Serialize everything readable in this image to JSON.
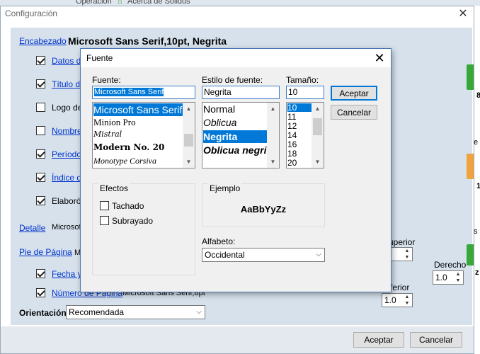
{
  "background": {
    "menu_operacion": "Operación",
    "menu_acerca": "Acerca de Solidus"
  },
  "config": {
    "title": "Configuración",
    "encabezado": {
      "label": "Encabezado",
      "font_value": "Microsoft Sans Serif,10pt, Negrita"
    },
    "encabezado_items": [
      {
        "label": "Datos de",
        "checked": true,
        "link": true
      },
      {
        "label": "Título del",
        "checked": true,
        "link": true
      },
      {
        "label": "Logo del I",
        "checked": false,
        "link": false
      },
      {
        "label": "Nombre d",
        "checked": false,
        "link": true
      },
      {
        "label": "Período",
        "checked": true,
        "link": true
      },
      {
        "label": "Índice del",
        "checked": true,
        "link": true
      },
      {
        "label": "Elaboró",
        "checked": true,
        "link": false
      }
    ],
    "detalle": {
      "label": "Detalle",
      "value": "Microsoft"
    },
    "pie": {
      "label": "Pie de Página",
      "value": "Mic"
    },
    "pie_items": [
      {
        "label": "Fecha y H",
        "checked": true,
        "value": ""
      },
      {
        "label": "Número de Página",
        "checked": true,
        "value": "Microsoft Sans Serif,8pt"
      }
    ],
    "orientacion": {
      "label": "Orientación",
      "value": "Recomendada"
    },
    "margins": {
      "superior_label": "uperior",
      "superior_value": "0",
      "derecho_label": "Derecho",
      "derecho_value": "1.0",
      "inferior_label": "ferior",
      "inferior_value": "1.0"
    },
    "side_fragments": {
      "a": "8",
      "b": "e",
      "c": "1",
      "d": "s",
      "e": "z"
    },
    "accept_label": "Aceptar",
    "cancel_label": "Cancelar"
  },
  "font_dialog": {
    "title": "Fuente",
    "fuente_label": "Fuente:",
    "fuente_value": "Microsoft Sans Serif",
    "fuente_list": [
      "Microsoft Sans Serif",
      "Minion Pro",
      "Mistral",
      "Modern No. 20",
      "Monotype Corsiva"
    ],
    "estilo_label": "Estilo de fuente:",
    "estilo_value": "Negrita",
    "estilo_list": [
      "Normal",
      "Oblicua",
      "Negrita",
      "Oblicua negrita"
    ],
    "tamano_label": "Tamaño:",
    "tamano_value": "10",
    "tamano_list": [
      "10",
      "11",
      "12",
      "14",
      "16",
      "18",
      "20"
    ],
    "accept_label": "Aceptar",
    "cancel_label": "Cancelar",
    "efectos_label": "Efectos",
    "tachado_label": "Tachado",
    "subrayado_label": "Subrayado",
    "ejemplo_label": "Ejemplo",
    "ejemplo_text": "AaBbYyZz",
    "alfabeto_label": "Alfabeto:",
    "alfabeto_value": "Occidental",
    "accent_color": "#0078d7"
  }
}
